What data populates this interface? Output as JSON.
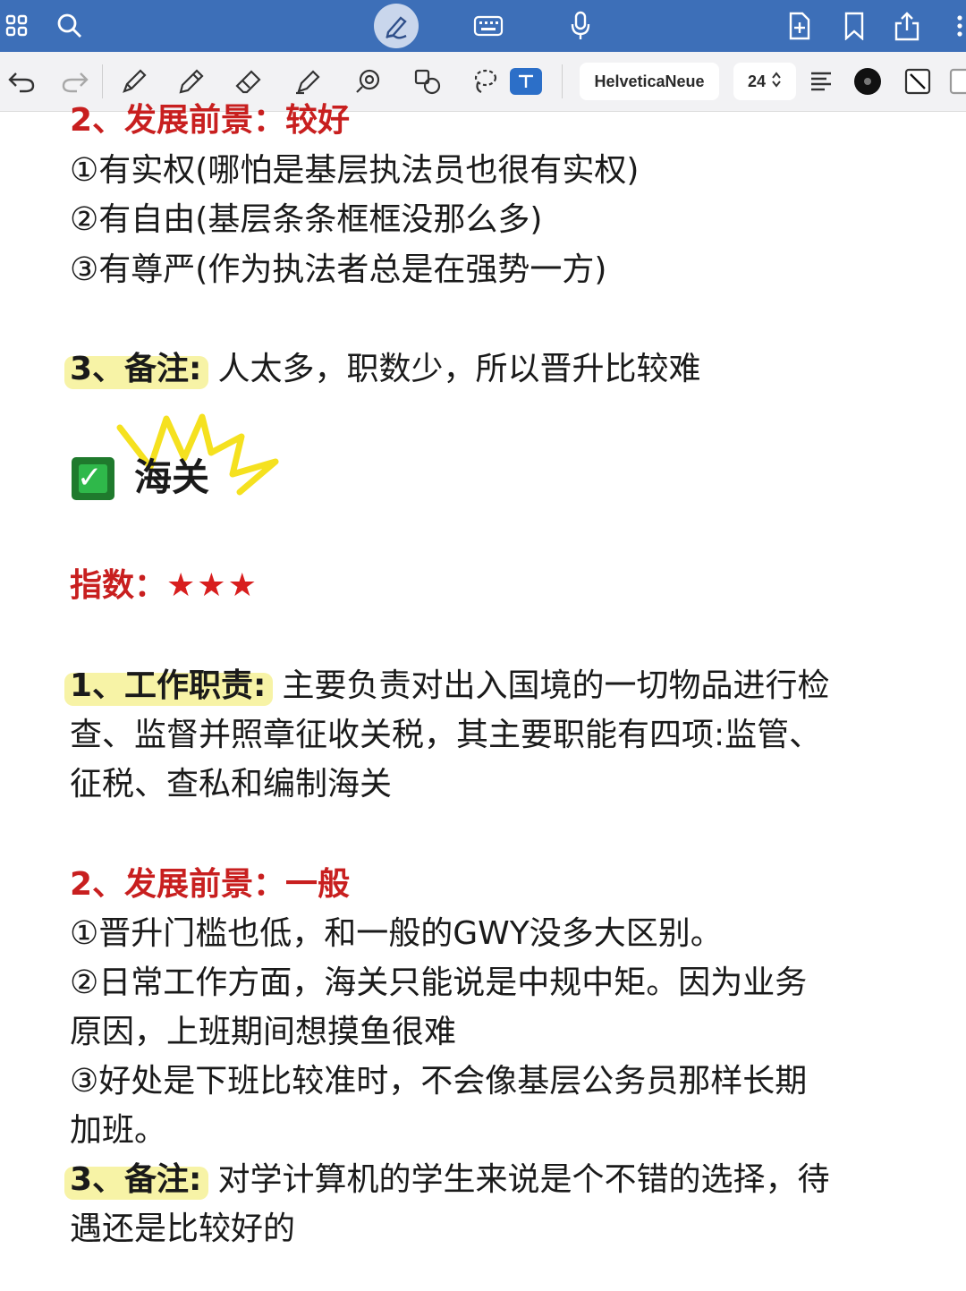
{
  "top_bar": {
    "icons": [
      "grid-icon",
      "search-icon",
      "pen-mode-icon",
      "keyboard-icon",
      "microphone-icon",
      "add-page-icon",
      "bookmark-icon",
      "share-icon",
      "more-icon"
    ]
  },
  "toolbar": {
    "font_name": "HelveticaNeue",
    "font_size": "24",
    "color_accent": "#2c6fc8"
  },
  "document": {
    "s1_prospect_title": "2、发展前景：较好",
    "s1_items": [
      "①有实权(哪怕是基层执法员也很有实权)",
      "②有自由(基层条条框框没那么多)",
      "③有尊严(作为执法者总是在强势一方)"
    ],
    "s1_note_label": "3、备注:",
    "s1_note_text": "人太多，职数少，所以晋升比较难",
    "customs_title": "海关",
    "index_label": "指数：",
    "index_stars": "★★★",
    "duty_label": "1、工作职责:",
    "duty_line1": "主要负责对出入国境的一切物品进行检",
    "duty_line2": "查、监督并照章征收关税，其主要职能有四项:监管、",
    "duty_line3": "征税、查私和编制海关",
    "s2_prospect_title": "2、发展前景：一般",
    "s2_item1": "①晋升门槛也低，和一般的GWY没多大区别。",
    "s2_item2_l1": "②日常工作方面，海关只能说是中规中矩。因为业务",
    "s2_item2_l2": "原因，上班期间想摸鱼很难",
    "s2_item3_l1": "③好处是下班比较准时，不会像基层公务员那样长期",
    "s2_item3_l2": "加班。",
    "s2_note_label": "3、备注:",
    "s2_note_l1": "对学计算机的学生来说是个不错的选择，待",
    "s2_note_l2": "遇还是比较好的"
  }
}
